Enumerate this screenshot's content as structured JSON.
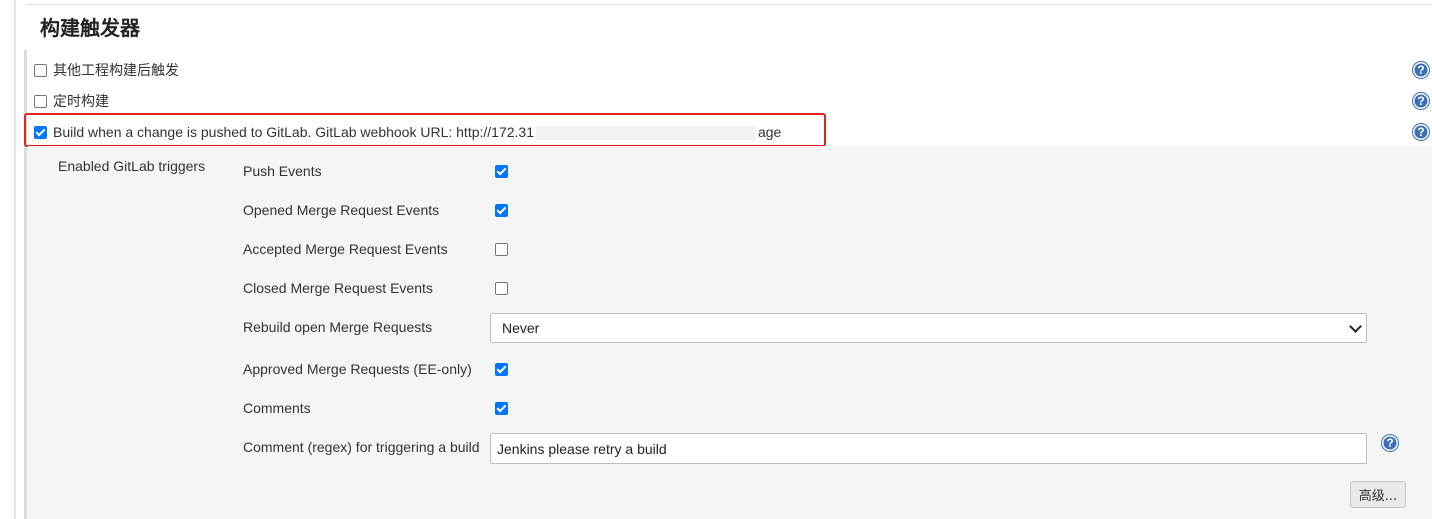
{
  "section": {
    "title": "构建触发器"
  },
  "triggers": {
    "other_projects": {
      "label": "其他工程构建后触发",
      "checked": false
    },
    "periodic": {
      "label": "定时构建",
      "checked": false
    },
    "gitlab": {
      "label_prefix": "Build when a change is pushed to GitLab. GitLab webhook URL: http://172.31",
      "label_suffix": "age",
      "checked": true
    }
  },
  "gitlab_panel": {
    "label": "Enabled GitLab triggers",
    "events": [
      {
        "label": "Push Events",
        "checked": true
      },
      {
        "label": "Opened Merge Request Events",
        "checked": true
      },
      {
        "label": "Accepted Merge Request Events",
        "checked": false
      },
      {
        "label": "Closed Merge Request Events",
        "checked": false
      }
    ],
    "rebuild": {
      "label": "Rebuild open Merge Requests",
      "value": "Never"
    },
    "approved": {
      "label": "Approved Merge Requests (EE-only)",
      "checked": true
    },
    "comments": {
      "label": "Comments",
      "checked": true
    },
    "comment_regex": {
      "label": "Comment (regex) for triggering a build",
      "value": "Jenkins please retry a build"
    },
    "advanced_button": "高级..."
  },
  "help_icon_glyph": "?",
  "colors": {
    "highlight": "#e02424",
    "checkbox": "#0075ff",
    "help": "#3b6fb6"
  }
}
